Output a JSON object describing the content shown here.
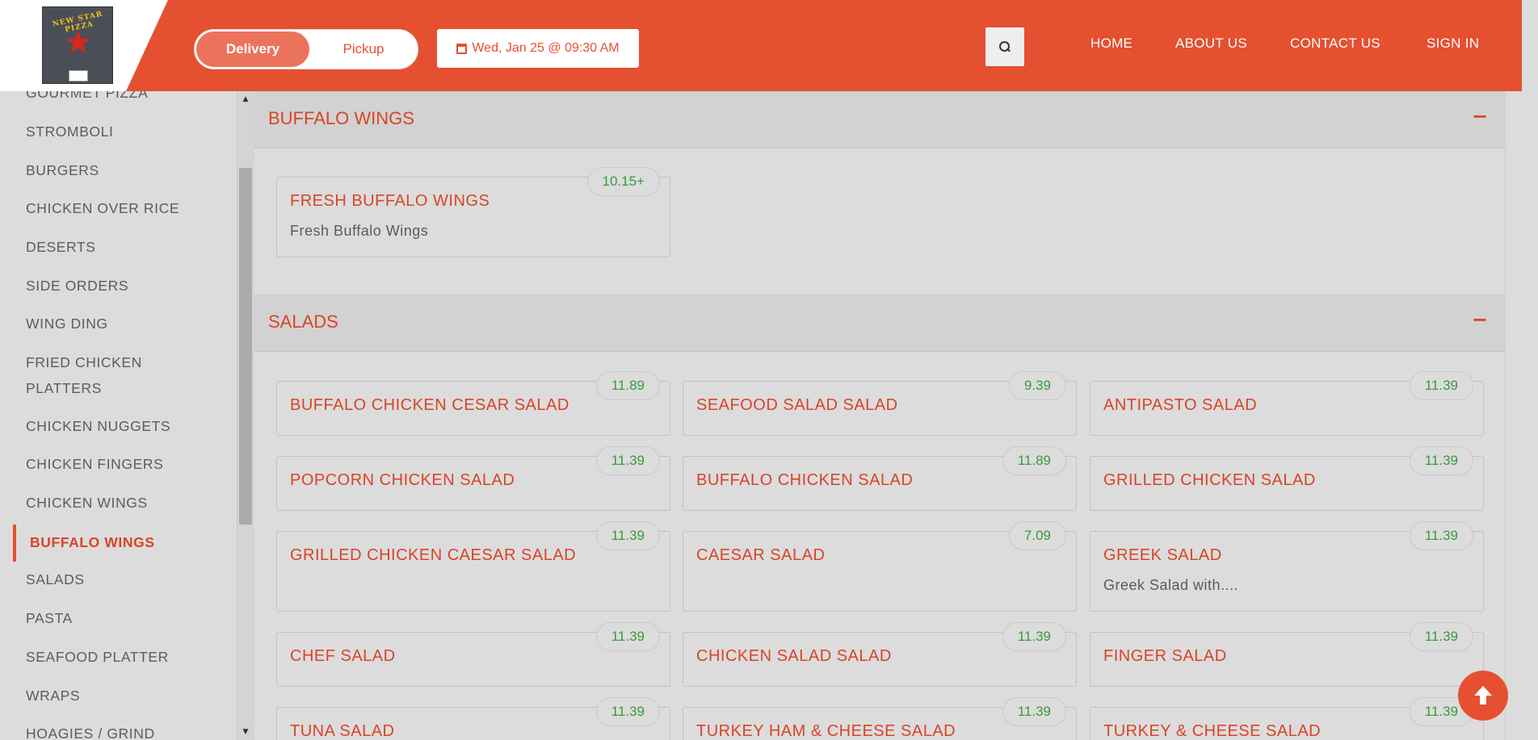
{
  "brand": {
    "logo_text": "NEW STAR PIZZA",
    "logo_icon": "star-icon"
  },
  "header": {
    "order_type": {
      "delivery": "Delivery",
      "pickup": "Pickup",
      "selected": "Delivery"
    },
    "datetime": "Wed, Jan 25 @ 09:30 AM",
    "nav": [
      "HOME",
      "ABOUT US",
      "CONTACT US",
      "SIGN IN"
    ],
    "accent_color": "#e55030"
  },
  "sidebar": {
    "items": [
      "GOURMET PIZZA",
      "STROMBOLI",
      "BURGERS",
      "CHICKEN OVER RICE",
      "DESERTS",
      "SIDE ORDERS",
      "WING DING",
      "FRIED CHICKEN PLATTERS",
      "CHICKEN NUGGETS",
      "CHICKEN FINGERS",
      "CHICKEN WINGS",
      "BUFFALO WINGS",
      "SALADS",
      "PASTA",
      "SEAFOOD PLATTER",
      "WRAPS",
      "HOAGIES / GRIND"
    ],
    "fried_line1": "FRIED CHICKEN",
    "fried_line2": "PLATTERS",
    "active": "BUFFALO WINGS"
  },
  "sections": [
    {
      "title": "BUFFALO WINGS",
      "toggle": "−",
      "items": [
        {
          "name": "FRESH BUFFALO WINGS",
          "desc": "Fresh Buffalo Wings",
          "price": "10.15+"
        }
      ]
    },
    {
      "title": "SALADS",
      "toggle": "−",
      "items": [
        {
          "name": "BUFFALO CHICKEN CESAR SALAD",
          "desc": "",
          "price": "11.89"
        },
        {
          "name": "SEAFOOD SALAD SALAD",
          "desc": "",
          "price": "9.39"
        },
        {
          "name": "ANTIPASTO SALAD",
          "desc": "",
          "price": "11.39"
        },
        {
          "name": "POPCORN CHICKEN SALAD",
          "desc": "",
          "price": "11.39"
        },
        {
          "name": "BUFFALO CHICKEN SALAD",
          "desc": "",
          "price": "11.89"
        },
        {
          "name": "GRILLED CHICKEN SALAD",
          "desc": "",
          "price": "11.39"
        },
        {
          "name": "GRILLED CHICKEN CAESAR SALAD",
          "desc": "",
          "price": "11.39"
        },
        {
          "name": "CAESAR SALAD",
          "desc": "",
          "price": "7.09"
        },
        {
          "name": "GREEK SALAD",
          "desc": "Greek Salad with....",
          "price": "11.39"
        },
        {
          "name": "CHEF SALAD",
          "desc": "",
          "price": "11.39"
        },
        {
          "name": "CHICKEN SALAD SALAD",
          "desc": "",
          "price": "11.39"
        },
        {
          "name": "FINGER SALAD",
          "desc": "",
          "price": "11.39"
        },
        {
          "name": "TUNA SALAD",
          "desc": "",
          "price": "11.39"
        },
        {
          "name": "TURKEY HAM & CHEESE SALAD",
          "desc": "",
          "price": "11.39"
        },
        {
          "name": "TURKEY & CHEESE SALAD",
          "desc": "",
          "price": "11.39"
        }
      ]
    }
  ]
}
